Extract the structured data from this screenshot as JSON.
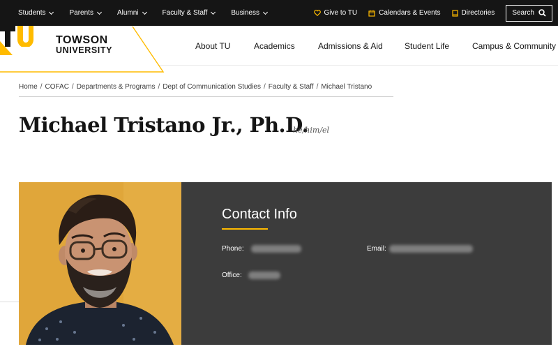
{
  "utility": {
    "left_items": [
      "Students",
      "Parents",
      "Alumni",
      "Faculty & Staff",
      "Business"
    ],
    "give": "Give to TU",
    "calendars": "Calendars & Events",
    "directories": "Directories",
    "search": "Search"
  },
  "logo": {
    "line1": "TOWSON",
    "line2": "UNIVERSITY",
    "mark": "TU"
  },
  "nav": [
    "About TU",
    "Academics",
    "Admissions & Aid",
    "Student Life",
    "Campus & Community"
  ],
  "breadcrumb": {
    "items": [
      "Home",
      "COFAC",
      "Departments & Programs",
      "Dept of Communication Studies",
      "Faculty & Staff"
    ],
    "current": "Michael Tristano"
  },
  "profile": {
    "name": "Michael Tristano Jr., Ph.D.",
    "pronouns": "he/him/el"
  },
  "contact": {
    "title": "Contact Info",
    "phone_label": "Phone:",
    "email_label": "Email:",
    "office_label": "Office:"
  },
  "colors": {
    "gold": "#ffbb00",
    "dark": "#151515",
    "panel": "#3c3c3c"
  }
}
